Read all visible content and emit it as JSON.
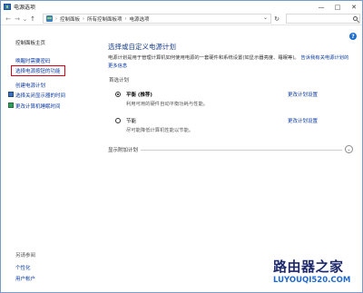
{
  "window": {
    "title": "电源选项",
    "controls": {
      "minimize": "—",
      "maximize": "□",
      "close": "✕"
    }
  },
  "address": {
    "crumbs": [
      "控制面板",
      "所有控制面板项",
      "电源选项"
    ],
    "refresh_glyph": "↻",
    "dropdown_glyph": "⌄"
  },
  "nav": {
    "back": "←",
    "forward": "→",
    "recent": "⌄",
    "up": "↑"
  },
  "help_glyph": "?",
  "sidebar": {
    "home": "控制面板主页",
    "links": [
      "唤醒时需要密码",
      "选择电源按钮的功能",
      "创建电源计划",
      "选择关闭显示器的时间",
      "更改计算机睡眠时间"
    ],
    "see_also": {
      "heading": "另请参阅",
      "links": [
        "个性化",
        "用户帐户"
      ]
    }
  },
  "main": {
    "title": "选择或自定义电源计划",
    "description": "电源计划是用于管理计算机如何使用电源的一套硬件和系统设置(如显示器亮度、睡眠等)。",
    "description_link": "告诉我有关电源计划的更多信息",
    "section_label": "首选计划",
    "plans": [
      {
        "name": "平衡 (推荐)",
        "desc": "利用可用的硬件自动平衡功耗与性能。",
        "link": "更改计划设置",
        "selected": true
      },
      {
        "name": "节能",
        "desc": "尽可能降低计算机性能以节能。",
        "link": "更改计划设置",
        "selected": false
      }
    ],
    "more_plans": "显示附加计划",
    "more_toggle_glyph": "⌄"
  },
  "watermark": {
    "logo": "路由器之家",
    "url": "LUYOUQI520.COM"
  }
}
